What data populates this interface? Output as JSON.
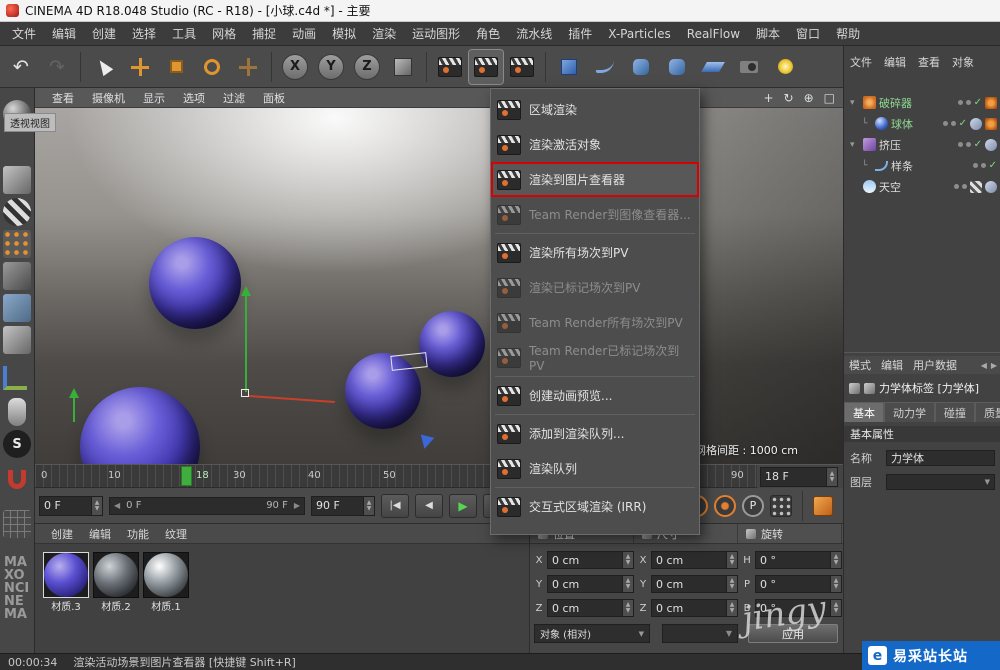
{
  "window": {
    "title": "CINEMA 4D R18.048 Studio (RC - R18) - [小球.c4d *] - 主要"
  },
  "menu_bar": {
    "items": [
      "文件",
      "编辑",
      "创建",
      "选择",
      "工具",
      "网格",
      "捕捉",
      "动画",
      "模拟",
      "渲染",
      "运动图形",
      "角色",
      "流水线",
      "插件",
      "X-Particles",
      "RealFlow",
      "脚本",
      "窗口",
      "帮助"
    ]
  },
  "toolbar": {
    "x": "X",
    "y": "Y",
    "z": "Z"
  },
  "viewport": {
    "menus": [
      "查看",
      "摄像机",
      "显示",
      "选项",
      "过滤",
      "面板"
    ],
    "view_label": "透视视图",
    "grid_spacing": "网格间距 : 1000 cm"
  },
  "render_menu": {
    "items": [
      "区域渲染",
      "渲染激活对象",
      "渲染到图片查看器",
      "Team Render到图像查看器...",
      "渲染所有场次到PV",
      "渲染已标记场次到PV",
      "Team Render所有场次到PV",
      "Team Render已标记场次到PV",
      "创建动画预览...",
      "添加到渲染队列...",
      "渲染队列",
      "交互式区域渲染 (IRR)"
    ]
  },
  "object_manager": {
    "menus": [
      "文件",
      "编辑",
      "查看",
      "对象"
    ],
    "objects": [
      "破碎器",
      "球体",
      "挤压",
      "样条",
      "天空"
    ]
  },
  "attributes": {
    "menus": [
      "模式",
      "编辑",
      "用户数据"
    ],
    "tag_title": "力学体标签 [力学体]",
    "tabs": [
      "基本",
      "动力学",
      "碰撞",
      "质量"
    ],
    "section": "基本属性",
    "name_label": "名称",
    "name_value": "力学体",
    "layer_label": "图层"
  },
  "timeline": {
    "ticks": [
      "0",
      "10",
      "30",
      "40",
      "50",
      "90"
    ],
    "playhead": "18",
    "frame_field": "18 F"
  },
  "transport": {
    "start_frame": "0 F",
    "range_start": "0 F",
    "range_end": "90 F",
    "end_frame": "90 F",
    "p_label": "P"
  },
  "materials": {
    "menus": [
      "创建",
      "编辑",
      "功能",
      "纹理"
    ],
    "items": [
      "材质.3",
      "材质.2",
      "材质.1"
    ]
  },
  "coordinates": {
    "headers": [
      "位置",
      "尺寸",
      "旋转"
    ],
    "cells": [
      {
        "label": "X",
        "value": "0 cm"
      },
      {
        "label": "X",
        "value": "0 cm"
      },
      {
        "label": "H",
        "value": "0 °"
      },
      {
        "label": "Y",
        "value": "0 cm"
      },
      {
        "label": "Y",
        "value": "0 cm"
      },
      {
        "label": "P",
        "value": "0 °"
      },
      {
        "label": "Z",
        "value": "0 cm"
      },
      {
        "label": "Z",
        "value": "0 cm"
      },
      {
        "label": "B",
        "value": "0 °"
      }
    ],
    "mode": "对象 (相对)",
    "apply": "应用"
  },
  "status_bar": {
    "time": "00:00:34",
    "message": "渲染活动场景到图片查看器 [快捷键 Shift+R]"
  },
  "watermarks": {
    "handwriting": "jingy",
    "site": "易采站长站",
    "site_logo": "e"
  },
  "branding": {
    "vertical_text": "MAXONCINEMA"
  },
  "icons": {
    "undo": "↶",
    "redo": "↷",
    "up": "▲",
    "down": "▼",
    "left": "◀",
    "right": "▶",
    "play": "▶",
    "skip_start": "|◀",
    "skip_end": "▶|",
    "expand": "▾",
    "branch": "└",
    "check": "✓",
    "dropdown": "▼",
    "pan": "+",
    "orbit": "↻",
    "zoom": "⊕",
    "maximize": "□",
    "s_badge": "S"
  },
  "colors": {
    "highlight_red": "#d80000",
    "playhead_green": "#3fae3f",
    "watermark_blue": "#1469c8",
    "sphere_purple": "#5a4fd0",
    "accent_orange": "#e0962f"
  }
}
